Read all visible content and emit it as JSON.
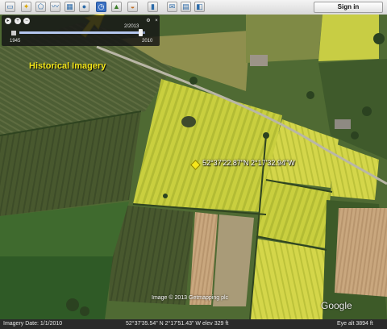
{
  "toolbar": {
    "buttons": [
      {
        "name": "sidebar-toggle",
        "icon": "sidebar-icon"
      },
      {
        "name": "add-placemark",
        "icon": "pushpin-icon"
      },
      {
        "name": "add-polygon",
        "icon": "polygon-icon"
      },
      {
        "name": "add-path",
        "icon": "path-icon"
      },
      {
        "name": "add-image-overlay",
        "icon": "image-overlay-icon"
      },
      {
        "name": "record-tour",
        "icon": "record-tour-icon"
      },
      {
        "name": "historical-imagery",
        "icon": "clock-icon",
        "active": true
      },
      {
        "name": "sunlight",
        "icon": "sunlight-icon"
      },
      {
        "name": "switch-to-sky",
        "icon": "planet-icon"
      },
      {
        "name": "ruler",
        "icon": "ruler-icon"
      },
      {
        "name": "email",
        "icon": "email-icon"
      },
      {
        "name": "print",
        "icon": "print-icon"
      },
      {
        "name": "view-in-maps",
        "icon": "maps-icon"
      }
    ],
    "signin_label": "Sign in"
  },
  "timeline": {
    "selected_date": "2/2013",
    "start_year": "1945",
    "end_year": "2010",
    "slider_position": 0.96
  },
  "map": {
    "annotation": "Historical Imagery",
    "placemark_label": "52°37'22.87\"N 2°17'32.94\"W",
    "copyright": "Image © 2013 Getmapping plc",
    "logo": "Google"
  },
  "status": {
    "imagery_date": "Imagery Date: 1/1/2010",
    "coordinates": "52°37'35.54\" N  2°17'51.43\" W  elev  329 ft",
    "eye_alt": "Eye alt  3894 ft"
  },
  "colors": {
    "highlight_arrow": "#f5e61a",
    "annotation_text": "#f2e51a",
    "active_button": "#3c72c4"
  }
}
